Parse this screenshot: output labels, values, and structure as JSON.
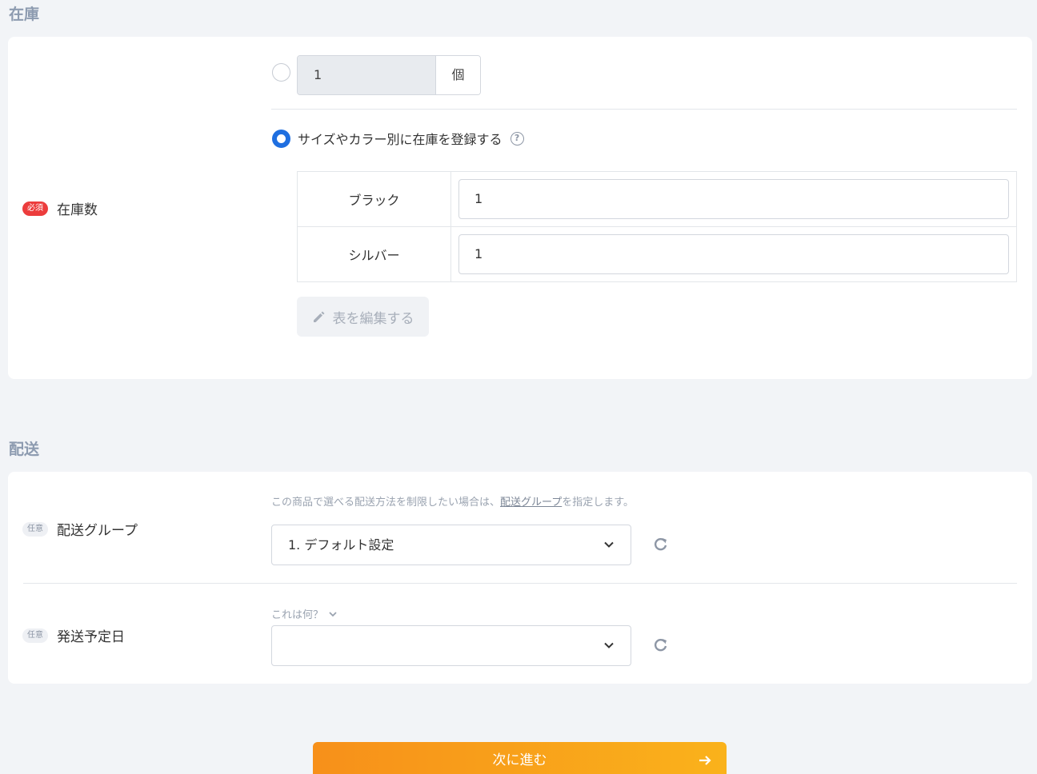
{
  "stock_section": {
    "title": "在庫",
    "field_label": "在庫数",
    "required_badge": "必須",
    "quantity_value": "1",
    "quantity_unit": "個",
    "variant_option_label": "サイズやカラー別に在庫を登録する",
    "variants": [
      {
        "name": "ブラック",
        "value": "1"
      },
      {
        "name": "シルバー",
        "value": "1"
      }
    ],
    "edit_table_label": "表を編集する"
  },
  "shipping_section": {
    "title": "配送",
    "group": {
      "optional_badge": "任意",
      "label": "配送グループ",
      "hint_before": "この商品で選べる配送方法を制限したい場合は、",
      "hint_link": "配送グループ",
      "hint_after": "を指定します。",
      "selected": "1. デフォルト設定"
    },
    "ship_date": {
      "optional_badge": "任意",
      "label": "発送予定日",
      "help_toggle": "これは何？",
      "selected": ""
    }
  },
  "next_button_label": "次に進む",
  "icons": {
    "help": "question-circle-icon",
    "edit": "pencil-icon",
    "dropdown": "chevron-down-icon",
    "refresh": "refresh-icon",
    "next": "arrow-right-icon"
  },
  "colors": {
    "accent": "#1f6fe0",
    "required": "#ec3c3c",
    "cta_start": "#f7901a",
    "cta_end": "#fab21b"
  }
}
